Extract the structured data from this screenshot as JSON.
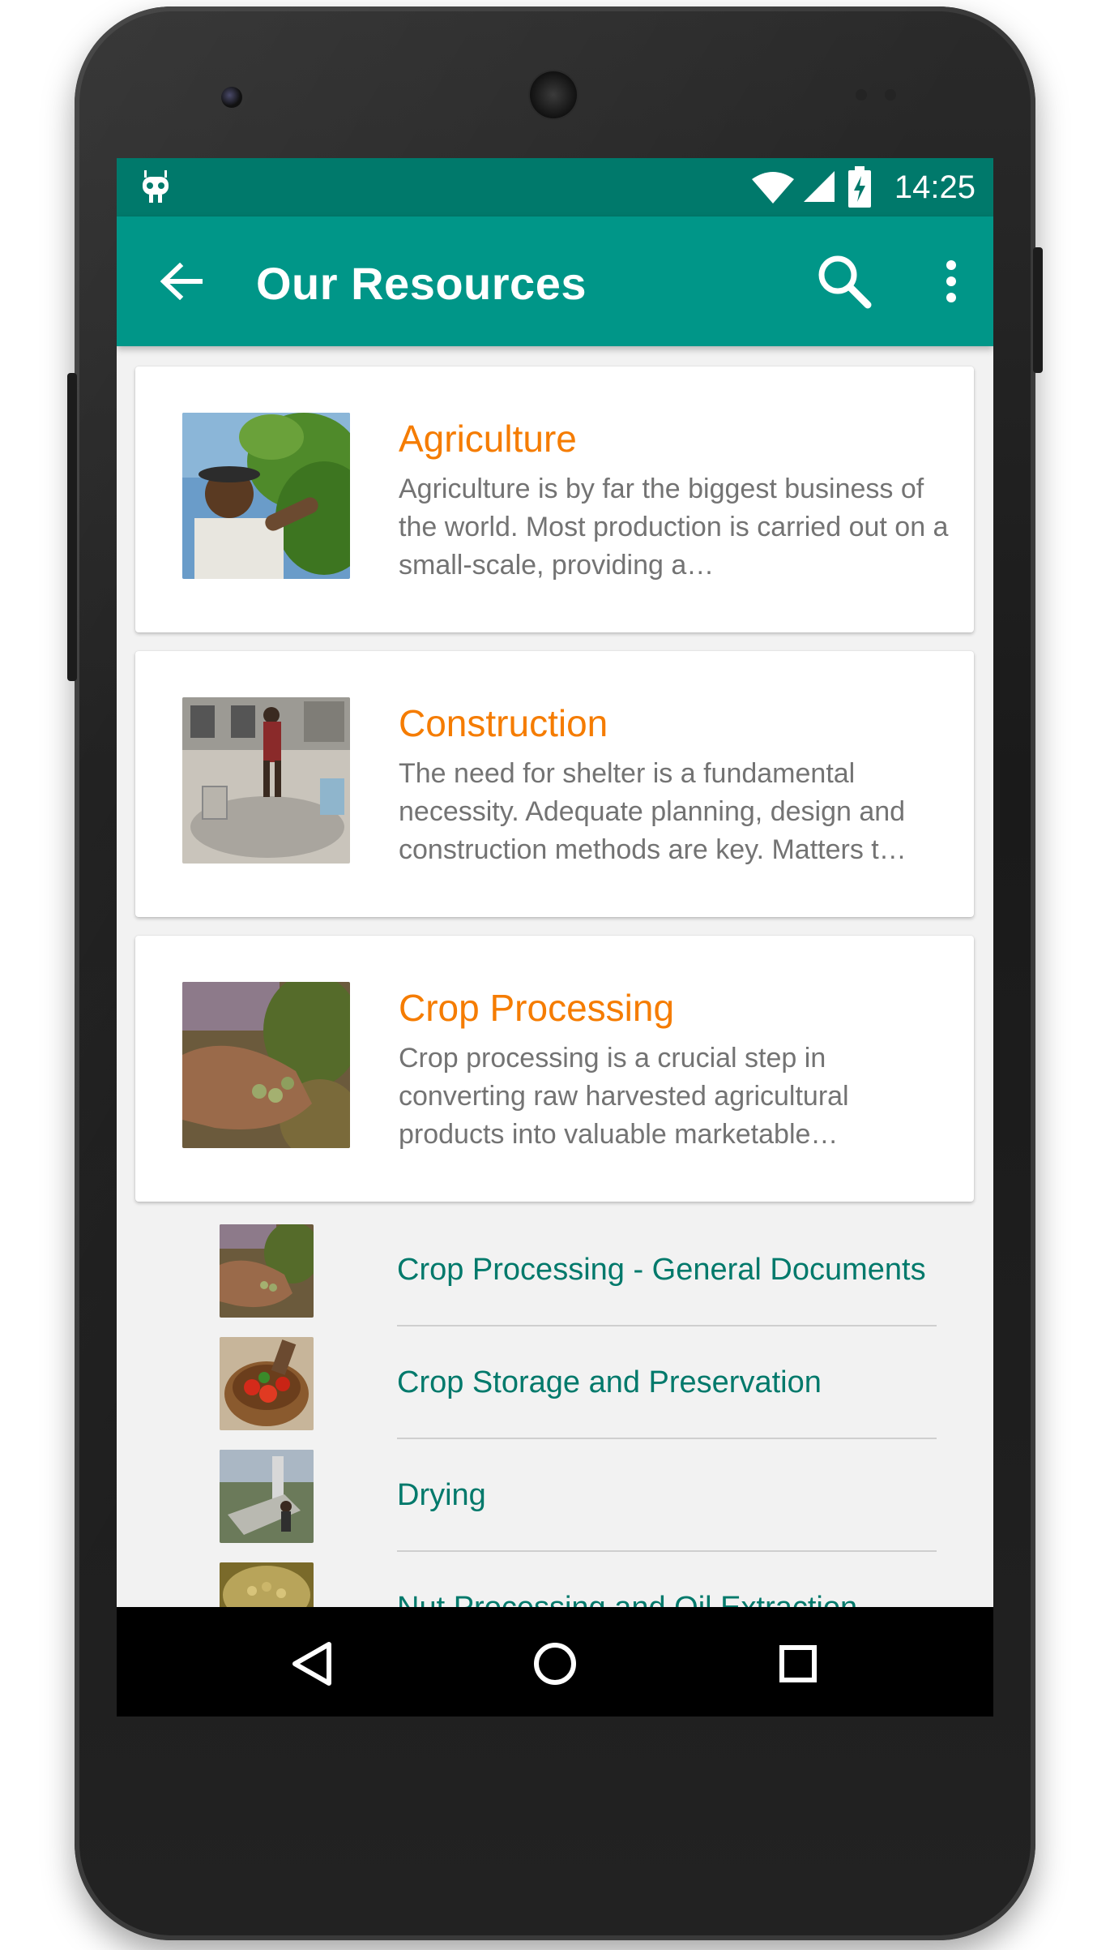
{
  "statusbar": {
    "time": "14:25",
    "icons": [
      "android-debug-icon",
      "wifi-icon",
      "signal-icon",
      "battery-charging-icon"
    ]
  },
  "appbar": {
    "title": "Our Resources",
    "back_icon": "arrow-back-icon",
    "search_icon": "search-icon",
    "menu_icon": "more-vert-icon"
  },
  "cards": [
    {
      "title": "Agriculture",
      "description": "Agriculture is by far the biggest business of the world. Most production is carried out on a small-scale, providing a…",
      "image": "farmer-picking-crops"
    },
    {
      "title": "Construction",
      "description": "The need for shelter is a fundamental necessity. Adequate planning, design and construction methods are key. Matters t…",
      "image": "worker-mixing-cement"
    },
    {
      "title": "Crop Processing",
      "description": "Crop processing is a crucial step in converting raw harvested agricultural products into valuable marketable…",
      "image": "hand-holding-seeds"
    }
  ],
  "sub_items": [
    {
      "label": "Crop Processing - General Documents",
      "image": "hand-holding-seeds"
    },
    {
      "label": "Crop Storage and Preservation",
      "image": "bowl-of-tomatoes"
    },
    {
      "label": "Drying",
      "image": "solar-dryer"
    },
    {
      "label": "Nut Processing and Oil Extraction",
      "image": "nuts-in-basket"
    }
  ],
  "navbar": {
    "back_icon": "nav-back-icon",
    "home_icon": "nav-home-icon",
    "recents_icon": "nav-recents-icon"
  },
  "colors": {
    "statusbar": "#00796b",
    "appbar": "#009688",
    "card_title": "#f57c00",
    "sub_label": "#00796b",
    "description": "#737373",
    "background": "#f2f2f2"
  }
}
